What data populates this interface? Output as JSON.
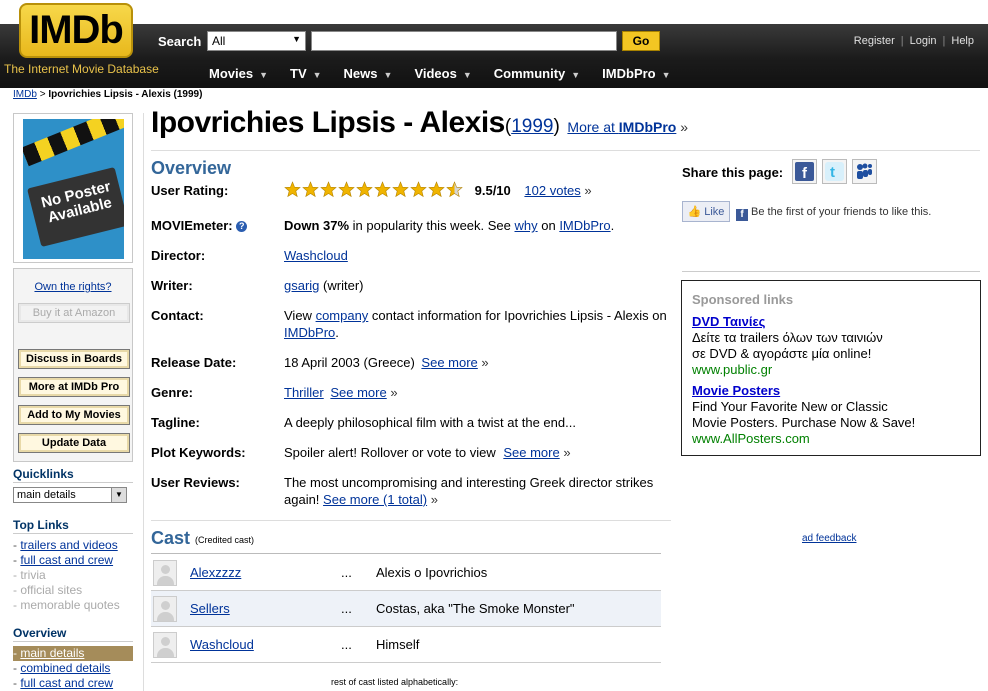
{
  "header": {
    "logo": "IMDb",
    "tagline": "The Internet Movie Database",
    "search_label": "Search",
    "search_category": "All",
    "search_placeholder": "",
    "go_label": "Go",
    "account_links": [
      "Register",
      "Login",
      "Help"
    ],
    "nav": [
      "Movies",
      "TV",
      "News",
      "Videos",
      "Community",
      "IMDbPro"
    ]
  },
  "breadcrumb": {
    "home": "IMDb",
    "separator": ">",
    "current": "Ipovrichies Lipsis - Alexis (1999)"
  },
  "sidebar": {
    "poster_text": "No Poster Available",
    "own_rights": "Own the rights?",
    "buttons": [
      "Buy it at Amazon",
      "Discuss in Boards",
      "More at IMDb Pro",
      "Add to My Movies",
      "Update Data"
    ],
    "quicklinks_heading": "Quicklinks",
    "quicklinks_selected": "main details",
    "toplinks_heading": "Top Links",
    "toplinks": [
      {
        "label": "trailers and videos",
        "enabled": true
      },
      {
        "label": "full cast and crew",
        "enabled": true
      },
      {
        "label": "trivia",
        "enabled": false
      },
      {
        "label": "official sites",
        "enabled": false
      },
      {
        "label": "memorable quotes",
        "enabled": false
      }
    ],
    "overview_heading": "Overview",
    "overview_links": [
      {
        "label": "main details",
        "active": true
      },
      {
        "label": "combined details",
        "active": false
      },
      {
        "label": "full cast and crew",
        "active": false
      }
    ]
  },
  "title": {
    "name": "Ipovrichies Lipsis - Alexis",
    "year": "1999",
    "pro_prefix": "More at ",
    "pro_brand": "IMDbPro",
    "pro_suffix": "»"
  },
  "overview": {
    "heading": "Overview",
    "rating": {
      "label": "User Rating:",
      "stars_total": 10,
      "stars_value": 9.5,
      "score": "9.5/10",
      "votes": "102 votes",
      "arrow": "»"
    },
    "moviemeter": {
      "label": "MOVIEmeter:",
      "help_icon": "?",
      "trend": "Down 37%",
      "text1": " in popularity this week. See ",
      "why": "why",
      "text2": " on ",
      "pro": "IMDbPro",
      "end": "."
    },
    "director": {
      "label": "Director:",
      "value": "Washcloud"
    },
    "writer": {
      "label": "Writer:",
      "value": "gsarig",
      "role": "(writer)"
    },
    "contact": {
      "label": "Contact:",
      "pre": "View ",
      "link": "company",
      "post": " contact information for Ipovrichies Lipsis - Alexis on ",
      "pro": "IMDbPro",
      "end": "."
    },
    "release": {
      "label": "Release Date:",
      "value": "18 April 2003 (Greece)",
      "see_more": "See more",
      "arrow": "»"
    },
    "genre": {
      "label": "Genre:",
      "value": "Thriller",
      "see_more": "See more",
      "arrow": "»"
    },
    "tagline": {
      "label": "Tagline:",
      "value": "A deeply philosophical film with a twist at the end..."
    },
    "keywords": {
      "label": "Plot Keywords:",
      "value": "Spoiler alert! Rollover or vote to view",
      "see_more": "See more",
      "arrow": "»"
    },
    "reviews": {
      "label": "User Reviews:",
      "value": "The most uncompromising and interesting Greek director strikes again!",
      "see_more": "See more (1 total)",
      "arrow": "»"
    }
  },
  "cast": {
    "heading": "Cast",
    "subheading": "(Credited cast)",
    "rows": [
      {
        "actor": "Alexzzzz",
        "dots": "...",
        "character": "Alexis o Ipovrichios"
      },
      {
        "actor": "Sellers",
        "dots": "...",
        "character": "Costas, aka \"The Smoke Monster\""
      },
      {
        "actor": "Washcloud",
        "dots": "...",
        "character": "Himself"
      }
    ],
    "footer": "rest of cast listed alphabetically:"
  },
  "right": {
    "share_label": "Share this page:",
    "share_icons": [
      "facebook-icon",
      "twitter-icon",
      "myspace-icon"
    ],
    "fb_like": "Like",
    "fb_text": "Be the first of your friends to like this.",
    "ad": {
      "sponsored": "Sponsored links",
      "items": [
        {
          "title": "DVD Ταινίες",
          "line1": "Δείτε τα trailers όλων των ταινιών",
          "line2": "σε DVD & αγοράστε μία online!",
          "url": "www.public.gr"
        },
        {
          "title": "Movie Posters",
          "line1": "Find Your Favorite New or Classic",
          "line2": "Movie Posters. Purchase Now & Save!",
          "url": "www.AllPosters.com"
        }
      ]
    },
    "ad_feedback": "ad feedback"
  },
  "colors": {
    "accent_gold": "#f3c623",
    "link_blue": "#003399",
    "heading_blue": "#336699",
    "star_gold": "#f0b400"
  }
}
